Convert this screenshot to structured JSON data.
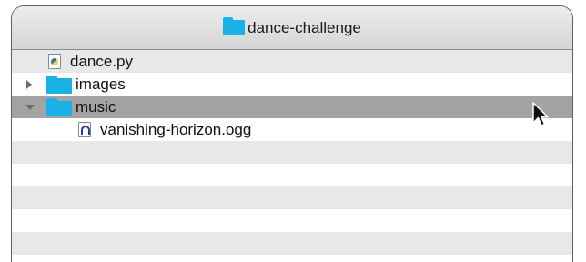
{
  "window": {
    "title": "dance-challenge",
    "title_icon": "folder-icon"
  },
  "items": [
    {
      "name": "dance.py",
      "kind": "file",
      "icon": "python-file-icon",
      "level": 1
    },
    {
      "name": "images",
      "kind": "folder",
      "icon": "folder-icon",
      "expanded": false,
      "level": 0
    },
    {
      "name": "music",
      "kind": "folder",
      "icon": "folder-icon",
      "expanded": true,
      "selected": true,
      "level": 0
    },
    {
      "name": "vanishing-horizon.ogg",
      "kind": "file",
      "icon": "ogg-file-icon",
      "level": 1
    }
  ],
  "colors": {
    "folder": "#1ab1e6",
    "selection": "#a3a3a3",
    "stripe": "#e8e8e8"
  }
}
